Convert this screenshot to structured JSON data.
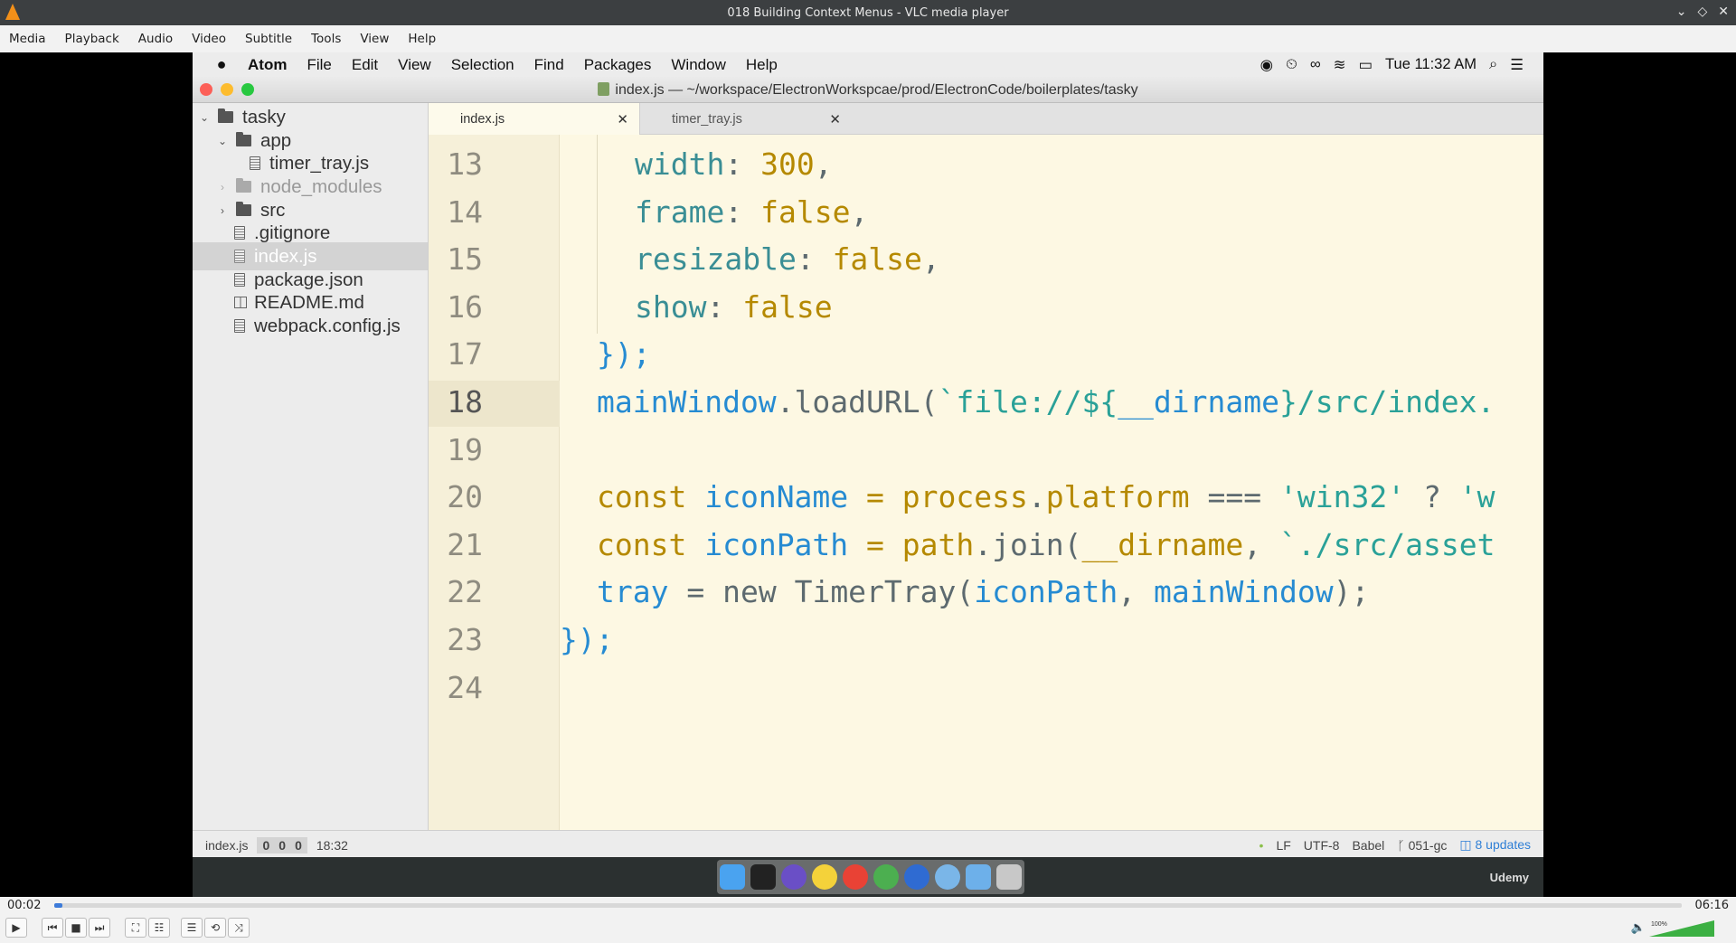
{
  "vlc": {
    "title": "018 Building Context Menus - VLC media player",
    "menu": [
      "Media",
      "Playback",
      "Audio",
      "Video",
      "Subtitle",
      "Tools",
      "View",
      "Help"
    ],
    "elapsed": "00:02",
    "total": "06:16",
    "progress_fraction": 0.005,
    "volume_label": "100%",
    "volume_fraction": 1.0
  },
  "mac": {
    "menu": [
      "Atom",
      "File",
      "Edit",
      "View",
      "Selection",
      "Find",
      "Packages",
      "Window",
      "Help"
    ],
    "clock": "Tue 11:32 AM"
  },
  "atom": {
    "window_title": "index.js — ~/workspace/ElectronWorkspcae/prod/ElectronCode/boilerplates/tasky",
    "tree": {
      "root": "tasky",
      "app_folder": "app",
      "timer_tray": "timer_tray.js",
      "node_modules": "node_modules",
      "src": "src",
      "gitignore": ".gitignore",
      "index": "index.js",
      "package": "package.json",
      "readme": "README.md",
      "webpack": "webpack.config.js"
    },
    "tabs": [
      "index.js",
      "timer_tray.js"
    ],
    "line_numbers": [
      "13",
      "14",
      "15",
      "16",
      "17",
      "18",
      "19",
      "20",
      "21",
      "22",
      "23",
      "24"
    ],
    "code": {
      "l13_a": "width",
      "l13_b": ": ",
      "l13_c": "300",
      "l13_d": ",",
      "l14_a": "frame",
      "l14_b": ": ",
      "l14_c": "false",
      "l14_d": ",",
      "l15_a": "resizable",
      "l15_b": ": ",
      "l15_c": "false",
      "l15_d": ",",
      "l16_a": "show",
      "l16_b": ": ",
      "l16_c": "false",
      "l17": "});",
      "l18_a": "mainWindow",
      "l18_b": ".loadURL(",
      "l18_c": "`file://${",
      "l18_d": "__dirname",
      "l18_e": "}/src/index.",
      "l20_a": "const ",
      "l20_b": "iconName",
      "l20_c": " = ",
      "l20_d": "process",
      "l20_e": ".",
      "l20_f": "platform",
      "l20_g": " === ",
      "l20_h": "'win32'",
      "l20_i": " ? ",
      "l20_j": "'w",
      "l21_a": "const ",
      "l21_b": "iconPath",
      "l21_c": " = ",
      "l21_d": "path",
      "l21_e": ".join(",
      "l21_f": "__dirname",
      "l21_g": ", ",
      "l21_h": "`./src/asset",
      "l22_a": "tray",
      "l22_b": " = ",
      "l22_c": "new ",
      "l22_d": "TimerTray(",
      "l22_e": "iconPath",
      "l22_f": ", ",
      "l22_g": "mainWindow",
      "l22_h": ");",
      "l23": "});"
    },
    "status": {
      "file": "index.js",
      "c1": "0",
      "c2": "0",
      "c3": "0",
      "cursor": "18:32",
      "eol": "LF",
      "encoding": "UTF-8",
      "grammar": "Babel",
      "branch": "051-gc",
      "updates": "8 updates"
    }
  },
  "watermark": "Udemy"
}
